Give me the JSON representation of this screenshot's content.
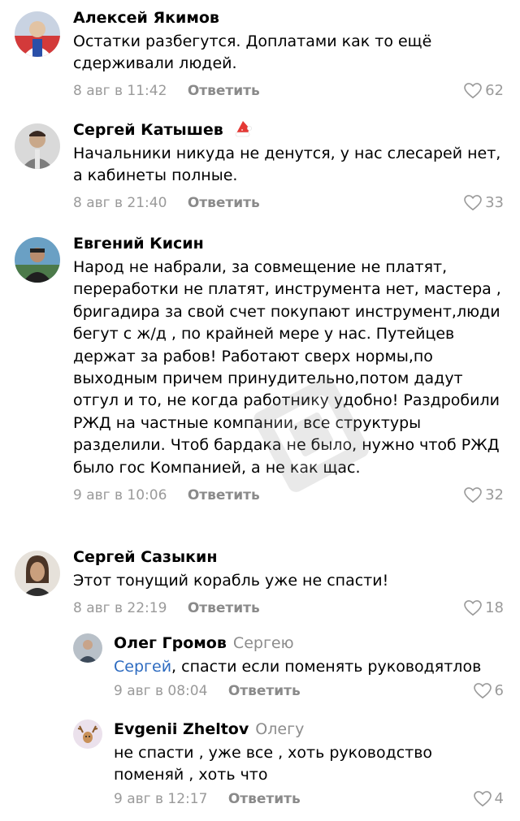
{
  "comments": [
    {
      "author": "Алексей Якимов",
      "reply_to": "",
      "text": "Остатки разбегутся. Доплатами как то ещё сдерживали людей.",
      "date": "8 авг в 11:42",
      "reply_label": "Ответить",
      "likes": "62",
      "avatar_icon": "person-avatar",
      "avatar_color": "#7a8fb0"
    },
    {
      "author": "Сергей Катышев",
      "reply_to": "",
      "badge_icon": "santa-hat-icon",
      "text": "Начальники никуда не денутся, у нас слесарей нет, а кабинеты полные.",
      "date": "8 авг в 21:40",
      "reply_label": "Ответить",
      "likes": "33",
      "avatar_icon": "person-avatar",
      "avatar_color": "#8a8a8a"
    },
    {
      "author": "Евгений Кисин",
      "reply_to": "",
      "text": "Народ не набрали, за совмещение не платят, переработки не платят, инструмента нет, мастера , бригадира за свой счет покупают инструмент,люди бегут с ж/д , по крайней мере у нас. Путейцев держат за рабов! Работают сверх нормы,по выходным причем принудительно,потом дадут отгул и то, не когда работнику удобно! Раздробили РЖД на частные компании, все структуры разделили. Чтоб бардака не было, нужно чтоб РЖД было гос Компанией, а не как щас.",
      "date": "9 авг в 10:06",
      "reply_label": "Ответить",
      "likes": "32",
      "avatar_icon": "person-avatar",
      "avatar_color": "#3f6a8a"
    },
    {
      "author": "Сергей Сазыкин",
      "reply_to": "",
      "text": "Этот тонущий корабль уже не спасти!",
      "date": "8 авг в 22:19",
      "reply_label": "Ответить",
      "likes": "18",
      "avatar_icon": "person-avatar",
      "avatar_color": "#a08a74"
    }
  ],
  "replies": [
    {
      "author": "Олег Громов",
      "reply_to": "Сергею",
      "mention": "Сергей",
      "text": ", спасти если поменять руководятлов",
      "date": "9 авг в 08:04",
      "reply_label": "Ответить",
      "likes": "6",
      "avatar_icon": "person-avatar",
      "avatar_color": "#5b6470"
    },
    {
      "author": "Evgenii Zheltov",
      "reply_to": "Олегу",
      "mention": "",
      "text": "не спасти , уже все , хоть руководство поменяй , хоть что",
      "date": "9 авг в 12:17",
      "reply_label": "Ответить",
      "likes": "4",
      "avatar_icon": "deer-avatar",
      "avatar_color": "#e9dfe9"
    }
  ],
  "colors": {
    "text": "#000000",
    "meta": "#9a9a9a",
    "mention": "#2d6bc0",
    "reply_to": "#8c8c8c"
  },
  "icons": {
    "like": "heart-outline-icon",
    "watermark": "watermark-logo"
  }
}
